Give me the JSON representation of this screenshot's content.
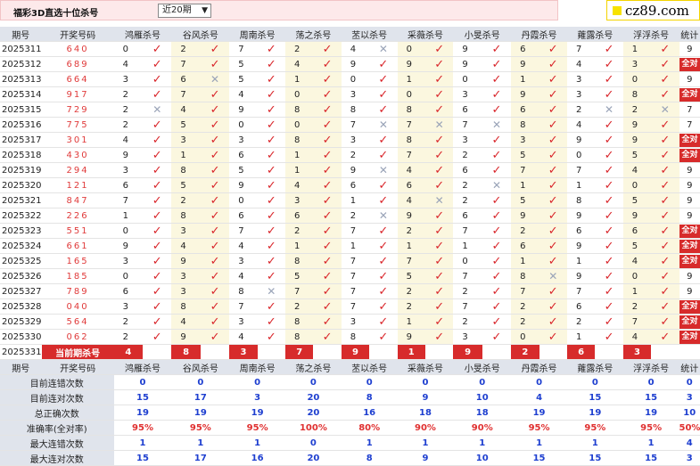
{
  "title": "福彩3D直选十位杀号",
  "period_select": {
    "value": "近20期"
  },
  "logo": {
    "text": "cz89.com"
  },
  "header": {
    "issue": "期号",
    "draw": "开奖号码",
    "experts": [
      "鸿雁杀号",
      "谷风杀号",
      "周南杀号",
      "荡之杀号",
      "苤以杀号",
      "采薇杀号",
      "小旻杀号",
      "丹霞杀号",
      "蕹露杀号",
      "浮浮杀号"
    ],
    "stat": "统计"
  },
  "rows": [
    {
      "issue": "2025311",
      "draw": "640",
      "picks": [
        [
          "0",
          1
        ],
        [
          "2",
          1
        ],
        [
          "7",
          1
        ],
        [
          "2",
          1
        ],
        [
          "4",
          0
        ],
        [
          "0",
          1
        ],
        [
          "9",
          1
        ],
        [
          "6",
          1
        ],
        [
          "7",
          1
        ],
        [
          "1",
          1
        ]
      ],
      "stat": "9"
    },
    {
      "issue": "2025312",
      "draw": "689",
      "picks": [
        [
          "4",
          1
        ],
        [
          "7",
          1
        ],
        [
          "5",
          1
        ],
        [
          "4",
          1
        ],
        [
          "9",
          1
        ],
        [
          "9",
          1
        ],
        [
          "9",
          1
        ],
        [
          "9",
          1
        ],
        [
          "4",
          1
        ],
        [
          "3",
          1
        ]
      ],
      "stat": "全对"
    },
    {
      "issue": "2025313",
      "draw": "664",
      "picks": [
        [
          "3",
          1
        ],
        [
          "6",
          0
        ],
        [
          "5",
          1
        ],
        [
          "1",
          1
        ],
        [
          "0",
          1
        ],
        [
          "1",
          1
        ],
        [
          "0",
          1
        ],
        [
          "1",
          1
        ],
        [
          "3",
          1
        ],
        [
          "0",
          1
        ]
      ],
      "stat": "9"
    },
    {
      "issue": "2025314",
      "draw": "917",
      "picks": [
        [
          "2",
          1
        ],
        [
          "7",
          1
        ],
        [
          "4",
          1
        ],
        [
          "0",
          1
        ],
        [
          "3",
          1
        ],
        [
          "0",
          1
        ],
        [
          "3",
          1
        ],
        [
          "9",
          1
        ],
        [
          "3",
          1
        ],
        [
          "8",
          1
        ]
      ],
      "stat": "全对"
    },
    {
      "issue": "2025315",
      "draw": "729",
      "picks": [
        [
          "2",
          0
        ],
        [
          "4",
          1
        ],
        [
          "9",
          1
        ],
        [
          "8",
          1
        ],
        [
          "8",
          1
        ],
        [
          "8",
          1
        ],
        [
          "6",
          1
        ],
        [
          "6",
          1
        ],
        [
          "2",
          0
        ],
        [
          "2",
          0
        ]
      ],
      "stat": "7"
    },
    {
      "issue": "2025316",
      "draw": "775",
      "picks": [
        [
          "2",
          1
        ],
        [
          "5",
          1
        ],
        [
          "0",
          1
        ],
        [
          "0",
          1
        ],
        [
          "7",
          0
        ],
        [
          "7",
          0
        ],
        [
          "7",
          0
        ],
        [
          "8",
          1
        ],
        [
          "4",
          1
        ],
        [
          "9",
          1
        ]
      ],
      "stat": "7"
    },
    {
      "issue": "2025317",
      "draw": "301",
      "picks": [
        [
          "4",
          1
        ],
        [
          "3",
          1
        ],
        [
          "3",
          1
        ],
        [
          "8",
          1
        ],
        [
          "3",
          1
        ],
        [
          "8",
          1
        ],
        [
          "3",
          1
        ],
        [
          "3",
          1
        ],
        [
          "9",
          1
        ],
        [
          "9",
          1
        ]
      ],
      "stat": "全对"
    },
    {
      "issue": "2025318",
      "draw": "430",
      "picks": [
        [
          "9",
          1
        ],
        [
          "1",
          1
        ],
        [
          "6",
          1
        ],
        [
          "1",
          1
        ],
        [
          "2",
          1
        ],
        [
          "7",
          1
        ],
        [
          "2",
          1
        ],
        [
          "5",
          1
        ],
        [
          "0",
          1
        ],
        [
          "5",
          1
        ]
      ],
      "stat": "全对"
    },
    {
      "issue": "2025319",
      "draw": "294",
      "picks": [
        [
          "3",
          1
        ],
        [
          "8",
          1
        ],
        [
          "5",
          1
        ],
        [
          "1",
          1
        ],
        [
          "9",
          0
        ],
        [
          "4",
          1
        ],
        [
          "6",
          1
        ],
        [
          "7",
          1
        ],
        [
          "7",
          1
        ],
        [
          "4",
          1
        ]
      ],
      "stat": "9"
    },
    {
      "issue": "2025320",
      "draw": "121",
      "picks": [
        [
          "6",
          1
        ],
        [
          "5",
          1
        ],
        [
          "9",
          1
        ],
        [
          "4",
          1
        ],
        [
          "6",
          1
        ],
        [
          "6",
          1
        ],
        [
          "2",
          0
        ],
        [
          "1",
          1
        ],
        [
          "1",
          1
        ],
        [
          "0",
          1
        ]
      ],
      "stat": "9"
    },
    {
      "issue": "2025321",
      "draw": "847",
      "picks": [
        [
          "7",
          1
        ],
        [
          "2",
          1
        ],
        [
          "0",
          1
        ],
        [
          "3",
          1
        ],
        [
          "1",
          1
        ],
        [
          "4",
          0
        ],
        [
          "2",
          1
        ],
        [
          "5",
          1
        ],
        [
          "8",
          1
        ],
        [
          "5",
          1
        ]
      ],
      "stat": "9"
    },
    {
      "issue": "2025322",
      "draw": "226",
      "picks": [
        [
          "1",
          1
        ],
        [
          "8",
          1
        ],
        [
          "6",
          1
        ],
        [
          "6",
          1
        ],
        [
          "2",
          0
        ],
        [
          "9",
          1
        ],
        [
          "6",
          1
        ],
        [
          "9",
          1
        ],
        [
          "9",
          1
        ],
        [
          "9",
          1
        ]
      ],
      "stat": "9"
    },
    {
      "issue": "2025323",
      "draw": "551",
      "picks": [
        [
          "0",
          1
        ],
        [
          "3",
          1
        ],
        [
          "7",
          1
        ],
        [
          "2",
          1
        ],
        [
          "7",
          1
        ],
        [
          "2",
          1
        ],
        [
          "7",
          1
        ],
        [
          "2",
          1
        ],
        [
          "6",
          1
        ],
        [
          "6",
          1
        ]
      ],
      "stat": "全对"
    },
    {
      "issue": "2025324",
      "draw": "661",
      "picks": [
        [
          "9",
          1
        ],
        [
          "4",
          1
        ],
        [
          "4",
          1
        ],
        [
          "1",
          1
        ],
        [
          "1",
          1
        ],
        [
          "1",
          1
        ],
        [
          "1",
          1
        ],
        [
          "6",
          1
        ],
        [
          "9",
          1
        ],
        [
          "5",
          1
        ]
      ],
      "stat": "全对"
    },
    {
      "issue": "2025325",
      "draw": "165",
      "picks": [
        [
          "3",
          1
        ],
        [
          "9",
          1
        ],
        [
          "3",
          1
        ],
        [
          "8",
          1
        ],
        [
          "7",
          1
        ],
        [
          "7",
          1
        ],
        [
          "0",
          1
        ],
        [
          "1",
          1
        ],
        [
          "1",
          1
        ],
        [
          "4",
          1
        ]
      ],
      "stat": "全对"
    },
    {
      "issue": "2025326",
      "draw": "185",
      "picks": [
        [
          "0",
          1
        ],
        [
          "3",
          1
        ],
        [
          "4",
          1
        ],
        [
          "5",
          1
        ],
        [
          "7",
          1
        ],
        [
          "5",
          1
        ],
        [
          "7",
          1
        ],
        [
          "8",
          0
        ],
        [
          "9",
          1
        ],
        [
          "0",
          1
        ]
      ],
      "stat": "9"
    },
    {
      "issue": "2025327",
      "draw": "789",
      "picks": [
        [
          "6",
          1
        ],
        [
          "3",
          1
        ],
        [
          "8",
          0
        ],
        [
          "7",
          1
        ],
        [
          "7",
          1
        ],
        [
          "2",
          1
        ],
        [
          "2",
          1
        ],
        [
          "7",
          1
        ],
        [
          "7",
          1
        ],
        [
          "1",
          1
        ]
      ],
      "stat": "9"
    },
    {
      "issue": "2025328",
      "draw": "040",
      "picks": [
        [
          "3",
          1
        ],
        [
          "8",
          1
        ],
        [
          "7",
          1
        ],
        [
          "2",
          1
        ],
        [
          "7",
          1
        ],
        [
          "2",
          1
        ],
        [
          "7",
          1
        ],
        [
          "2",
          1
        ],
        [
          "6",
          1
        ],
        [
          "2",
          1
        ]
      ],
      "stat": "全对"
    },
    {
      "issue": "2025329",
      "draw": "564",
      "picks": [
        [
          "2",
          1
        ],
        [
          "4",
          1
        ],
        [
          "3",
          1
        ],
        [
          "8",
          1
        ],
        [
          "3",
          1
        ],
        [
          "1",
          1
        ],
        [
          "2",
          1
        ],
        [
          "2",
          1
        ],
        [
          "2",
          1
        ],
        [
          "7",
          1
        ]
      ],
      "stat": "全对"
    },
    {
      "issue": "2025330",
      "draw": "062",
      "picks": [
        [
          "2",
          1
        ],
        [
          "9",
          1
        ],
        [
          "4",
          1
        ],
        [
          "8",
          1
        ],
        [
          "8",
          1
        ],
        [
          "9",
          1
        ],
        [
          "3",
          1
        ],
        [
          "0",
          1
        ],
        [
          "1",
          1
        ],
        [
          "4",
          1
        ]
      ],
      "stat": "全对"
    }
  ],
  "prediction": {
    "issue": "2025331",
    "label": "当前期杀号",
    "values": [
      "4",
      "8",
      "3",
      "7",
      "9",
      "1",
      "9",
      "2",
      "6",
      "3"
    ]
  },
  "stats": [
    {
      "label": "目前连错次数",
      "values": [
        "0",
        "0",
        "0",
        "0",
        "0",
        "0",
        "0",
        "0",
        "0",
        "0",
        "0"
      ],
      "pct": false
    },
    {
      "label": "目前连对次数",
      "values": [
        "15",
        "17",
        "3",
        "20",
        "8",
        "9",
        "10",
        "4",
        "15",
        "15",
        "3"
      ],
      "pct": false
    },
    {
      "label": "总正确次数",
      "values": [
        "19",
        "19",
        "19",
        "20",
        "16",
        "18",
        "18",
        "19",
        "19",
        "19",
        "10"
      ],
      "pct": false
    },
    {
      "label": "准确率(全对率)",
      "values": [
        "95%",
        "95%",
        "95%",
        "100%",
        "80%",
        "90%",
        "90%",
        "95%",
        "95%",
        "95%",
        "50%"
      ],
      "pct": true
    },
    {
      "label": "最大连错次数",
      "values": [
        "1",
        "1",
        "1",
        "0",
        "1",
        "1",
        "1",
        "1",
        "1",
        "1",
        "4"
      ],
      "pct": false
    },
    {
      "label": "最大连对次数",
      "values": [
        "15",
        "17",
        "16",
        "20",
        "8",
        "9",
        "10",
        "15",
        "15",
        "15",
        "3"
      ],
      "pct": false
    }
  ],
  "glyphs": {
    "ok": "✓",
    "no": "✕"
  }
}
